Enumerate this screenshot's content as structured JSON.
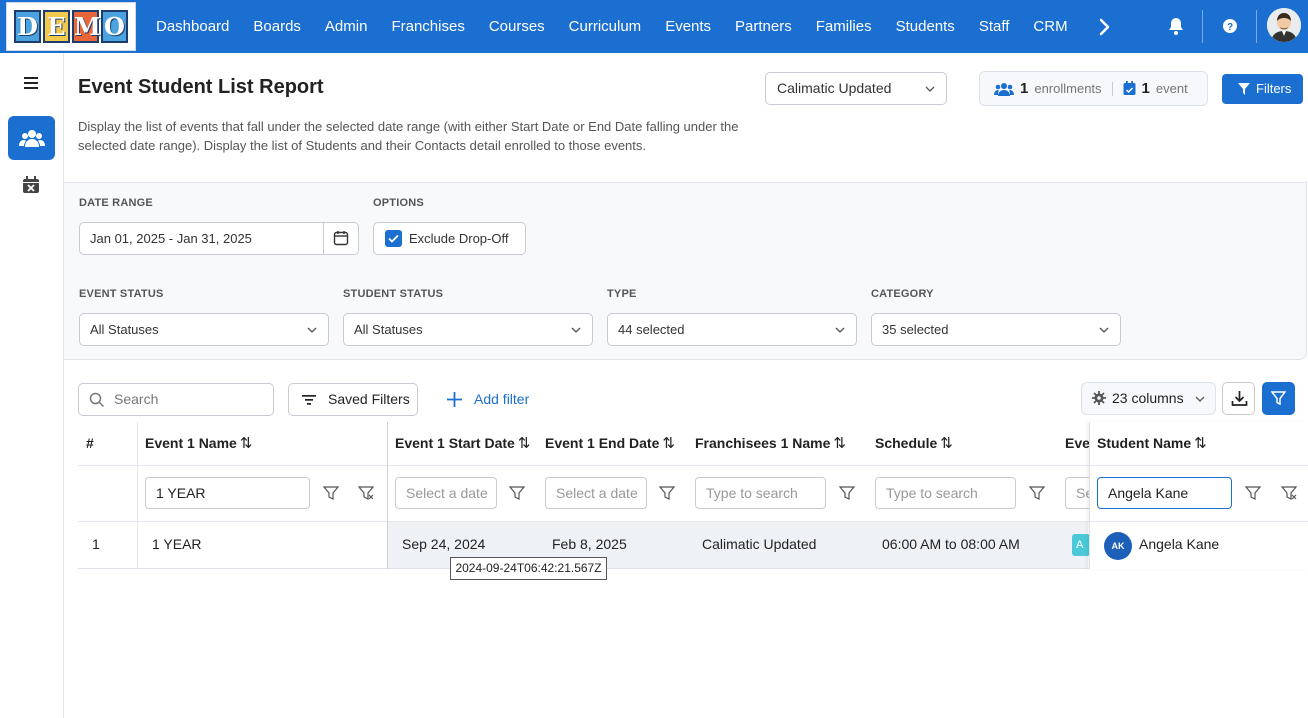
{
  "app": {
    "logo_letters": [
      "D",
      "E",
      "M",
      "O"
    ],
    "nav": [
      "Dashboard",
      "Boards",
      "Admin",
      "Franchises",
      "Courses",
      "Curriculum",
      "Events",
      "Partners",
      "Families",
      "Students",
      "Staff",
      "CRM"
    ],
    "colors": {
      "primary": "#1b6fd1",
      "badge": "#4cc9d8",
      "avatar": "#1b5fb8"
    }
  },
  "header": {
    "title": "Event Student List Report",
    "description": "Display the list of events that fall under the selected date range (with either Start Date or End Date falling under the selected date range). Display the list of Students and their Contacts detail enrolled to those events.",
    "franchise_select": "Calimatic Updated",
    "stats": {
      "enrollments_count": "1",
      "enrollments_label": "enrollments",
      "events_count": "1",
      "events_label": "event"
    },
    "filters_button": "Filters"
  },
  "filters": {
    "date_range_label": "DATE RANGE",
    "date_range_value": "Jan 01, 2025 - Jan 31, 2025",
    "options_label": "OPTIONS",
    "exclude_dropoff_label": "Exclude Drop-Off",
    "exclude_dropoff_checked": true,
    "event_status_label": "EVENT STATUS",
    "event_status_value": "All Statuses",
    "student_status_label": "STUDENT STATUS",
    "student_status_value": "All Statuses",
    "type_label": "TYPE",
    "type_value": "44 selected",
    "category_label": "CATEGORY",
    "category_value": "35 selected"
  },
  "toolbar": {
    "search_placeholder": "Search",
    "saved_filters": "Saved Filters",
    "add_filter": "Add filter",
    "columns": "23 columns"
  },
  "table": {
    "columns": {
      "index": "#",
      "event_name": "Event 1 Name",
      "start_date": "Event 1 Start Date",
      "end_date": "Event 1 End Date",
      "franchisee": "Franchisees 1 Name",
      "schedule": "Schedule",
      "truncated": "Eve",
      "student": "Student Name"
    },
    "sort_glyph": "⇅",
    "column_filters": {
      "event_name": "1 YEAR",
      "start_date_placeholder": "Select a date",
      "end_date_placeholder": "Select a date",
      "franchisee_placeholder": "Type to search",
      "schedule_placeholder": "Type to search",
      "truncated_placeholder": "Se",
      "student": "Angela Kane"
    },
    "rows": [
      {
        "index": "1",
        "event_name": "1 YEAR",
        "start_date": "Sep 24, 2024",
        "end_date": "Feb 8, 2025",
        "franchisee": "Calimatic Updated",
        "schedule": "06:00 AM to 08:00 AM",
        "badge": "A",
        "student_initials": "AK",
        "student_name": "Angela Kane"
      }
    ],
    "tooltip": "2024-09-24T06:42:21.567Z"
  }
}
